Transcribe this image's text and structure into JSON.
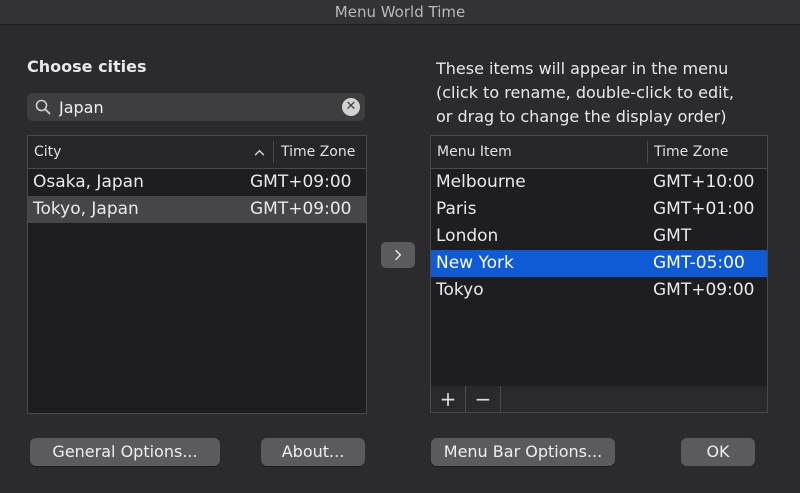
{
  "window": {
    "title": "Menu World Time"
  },
  "left": {
    "heading": "Choose cities",
    "search": {
      "value": "Japan",
      "placeholder": "Search"
    },
    "columns": {
      "city": "City",
      "timezone": "Time Zone"
    },
    "rows": [
      {
        "city": "Osaka, Japan",
        "tz": "GMT+09:00"
      },
      {
        "city": "Tokyo, Japan",
        "tz": "GMT+09:00"
      }
    ]
  },
  "right": {
    "caption": [
      "These items will appear in the menu",
      "(click to rename, double-click to edit,",
      "or drag to change the display order)"
    ],
    "columns": {
      "item": "Menu Item",
      "timezone": "Time Zone"
    },
    "rows": [
      {
        "name": "Melbourne",
        "tz": "GMT+10:00"
      },
      {
        "name": "Paris",
        "tz": "GMT+01:00"
      },
      {
        "name": "London",
        "tz": "GMT"
      },
      {
        "name": "New York",
        "tz": "GMT-05:00"
      },
      {
        "name": "Tokyo",
        "tz": "GMT+09:00"
      }
    ],
    "add_label": "+",
    "remove_label": "−"
  },
  "buttons": {
    "general": "General Options...",
    "about": "About...",
    "menubar": "Menu Bar Options...",
    "ok": "OK"
  },
  "icons": {
    "search": "search-icon",
    "clear": "clear-icon",
    "sort": "sort-ascending-icon",
    "arrow": "chevron-right-icon"
  },
  "colors": {
    "selection": "#0f5bd6",
    "background": "#2b2b2d"
  }
}
